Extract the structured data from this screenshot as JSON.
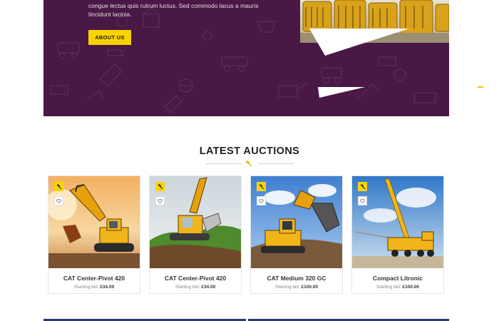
{
  "hero": {
    "text_line1": "congue lectus quis rutrum luctus. Sed commodo lacus a mauris",
    "text_line2": "tincidunt lacinia.",
    "about_button": "ABOUT US",
    "background_color": "#4a1845",
    "accent_color": "#f7d400"
  },
  "section": {
    "title": "LATEST AUCTIONS"
  },
  "auctions": [
    {
      "title": "CAT Center-Pivot 420",
      "bid_label": "Starting bid:",
      "bid_value": "£34.00"
    },
    {
      "title": "CAT Center-Pivot 420",
      "bid_label": "Starting bid:",
      "bid_value": "£34.00"
    },
    {
      "title": "CAT Medium 320 GC",
      "bid_label": "Starting bid:",
      "bid_value": "£100.00"
    },
    {
      "title": "Compact Litronic",
      "bid_label": "Starting bid:",
      "bid_value": "£100.00"
    }
  ],
  "icons": {
    "badge_top": "gavel-icon",
    "badge_bottom": "heart-icon"
  }
}
